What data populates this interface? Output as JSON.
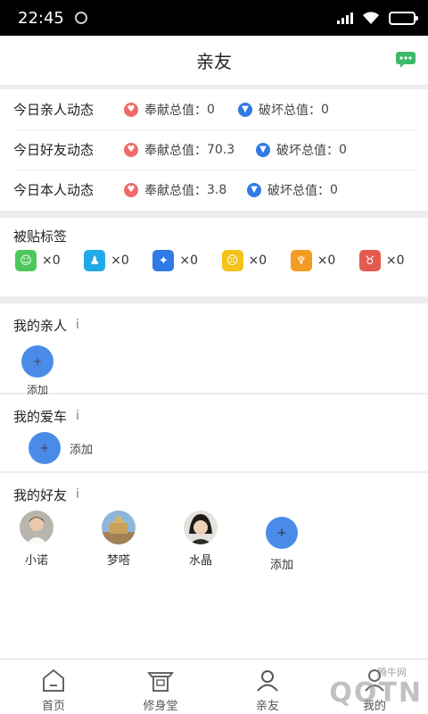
{
  "status": {
    "time": "22:45"
  },
  "header": {
    "title": "亲友",
    "message_icon": "chat-icon"
  },
  "dynamics": [
    {
      "label": "今日亲人动态",
      "contribute_label": "奉献总值：",
      "contribute": "0",
      "destroy_label": "破坏总值：",
      "destroy": "0"
    },
    {
      "label": "今日好友动态",
      "contribute_label": "奉献总值：",
      "contribute": "70.3",
      "destroy_label": "破坏总值：",
      "destroy": "0"
    },
    {
      "label": "今日本人动态",
      "contribute_label": "奉献总值：",
      "contribute": "3.8",
      "destroy_label": "破坏总值：",
      "destroy": "0"
    }
  ],
  "colors": {
    "contribute": "#ef6b6b",
    "destroy": "#2f7ae5",
    "accent": "#4a8be8"
  },
  "tags": {
    "title": "被贴标签",
    "items": [
      {
        "icon": "smile-icon",
        "color": "#4cc85a",
        "count": "×0"
      },
      {
        "icon": "person-icon",
        "color": "#21a9e8",
        "count": "×0"
      },
      {
        "icon": "angel-icon",
        "color": "#2f7ae5",
        "count": "×0"
      },
      {
        "icon": "sad-icon",
        "color": "#f3c31c",
        "count": "×0"
      },
      {
        "icon": "devil-icon",
        "color": "#f49b22",
        "count": "×0"
      },
      {
        "icon": "demon-icon",
        "color": "#e35a4f",
        "count": "×0"
      }
    ]
  },
  "family": {
    "title": "我的亲人",
    "info": "i",
    "add_label": "添加"
  },
  "car": {
    "title": "我的爱车",
    "info": "i",
    "add_label": "添加"
  },
  "friends": {
    "title": "我的好友",
    "info": "i",
    "items": [
      {
        "name": "小诺"
      },
      {
        "name": "梦嗒"
      },
      {
        "name": "水晶"
      }
    ],
    "add_label": "添加"
  },
  "tabs": [
    {
      "label": "首页",
      "icon": "home-icon"
    },
    {
      "label": "修身堂",
      "icon": "temple-icon"
    },
    {
      "label": "亲友",
      "icon": "friends-icon"
    },
    {
      "label": "我的",
      "icon": "profile-icon"
    }
  ],
  "watermark": {
    "text": "QQTN",
    "small": "腾牛网"
  }
}
